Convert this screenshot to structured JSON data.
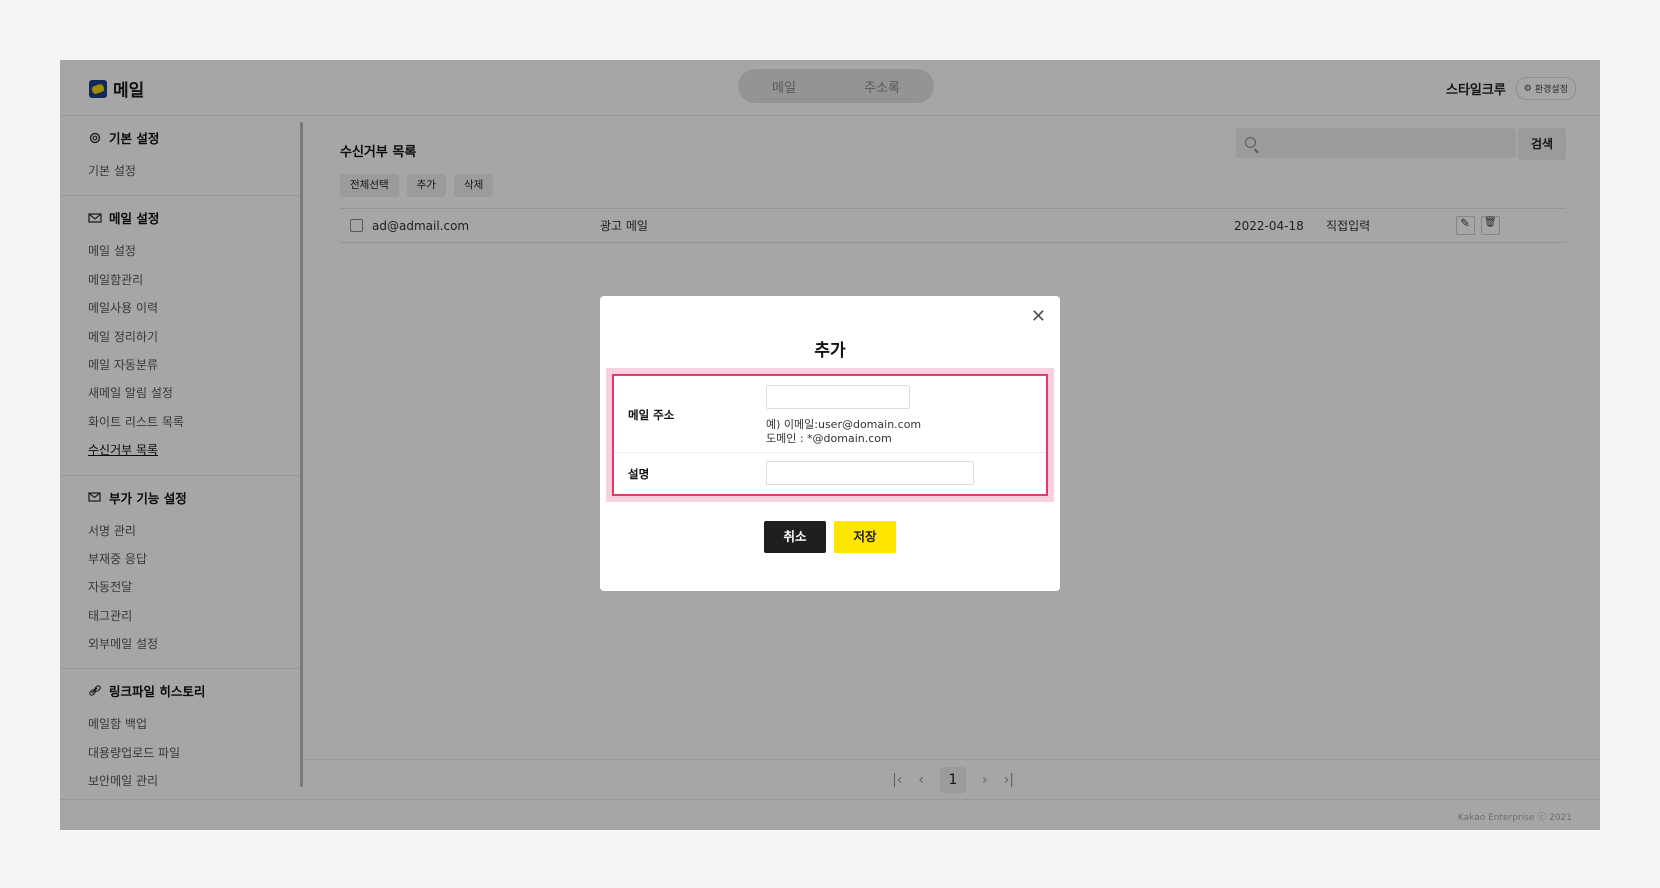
{
  "header": {
    "app_title": "메일",
    "nav_tabs": [
      "메일",
      "주소록"
    ],
    "org_name": "스타일크루",
    "settings_label": "환경설정"
  },
  "sidebar": {
    "sections": [
      {
        "title": "기본 설정",
        "icon": "gear-icon",
        "items": [
          "기본 설정"
        ]
      },
      {
        "title": "메일 설정",
        "icon": "mail-settings-icon",
        "items": [
          "메일 설정",
          "메일함관리",
          "메일사용 이력",
          "메일 정리하기",
          "메일 자동분류",
          "새메일 알림 설정",
          "화이트 리스트 목록",
          "수신거부 목록"
        ]
      },
      {
        "title": "부가 기능 설정",
        "icon": "mail-plus-icon",
        "items": [
          "서명 관리",
          "부재중 응답",
          "자동전달",
          "태그관리",
          "외부메일 설정"
        ]
      },
      {
        "title": "링크파일 히스토리",
        "icon": "link-icon",
        "items": [
          "메일함 백업",
          "대용량업로드 파일",
          "보안메일 관리"
        ]
      }
    ],
    "active_item": "수신거부 목록"
  },
  "main": {
    "title": "수신거부 목록",
    "search_placeholder": "",
    "search_button": "검색",
    "actions": [
      "전체선택",
      "추가",
      "삭제"
    ],
    "rows": [
      {
        "email": "ad@admail.com",
        "description": "광고 메일",
        "date": "2022-04-18",
        "source": "직접입력"
      }
    ],
    "pagination": {
      "current": "1"
    }
  },
  "footer": {
    "copyright": "Kakao Enterprise ⓒ 2021"
  },
  "modal": {
    "title": "추가",
    "email_label": "메일 주소",
    "email_value": "",
    "hint_line1": "예) 이메일:user@domain.com",
    "hint_line2": "도메인 : *@domain.com",
    "desc_label": "설명",
    "desc_value": "",
    "cancel_label": "취소",
    "save_label": "저장"
  },
  "colors": {
    "accent_yellow": "#ffe600",
    "highlight_border": "#e23a6b",
    "highlight_fill": "#f8d0de"
  }
}
